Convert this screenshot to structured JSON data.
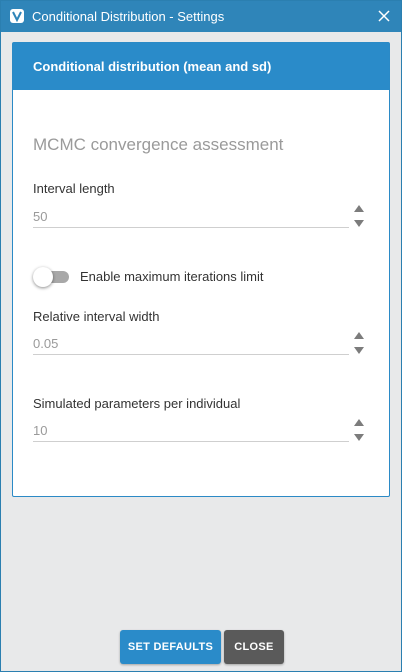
{
  "window": {
    "title": "Conditional Distribution - Settings",
    "accent_color": "#2f85b9"
  },
  "panel": {
    "header": "Conditional distribution (mean and sd)",
    "section_title": "MCMC convergence assessment",
    "fields": {
      "interval_length": {
        "label": "Interval length",
        "value": "50"
      },
      "relative_interval_width": {
        "label": "Relative interval width",
        "value": "0.05"
      },
      "simulated_parameters": {
        "label": "Simulated parameters per individual",
        "value": "10"
      }
    },
    "toggle": {
      "label": "Enable maximum iterations limit",
      "enabled": false
    }
  },
  "buttons": {
    "set_defaults": "SET DEFAULTS",
    "close": "CLOSE"
  }
}
